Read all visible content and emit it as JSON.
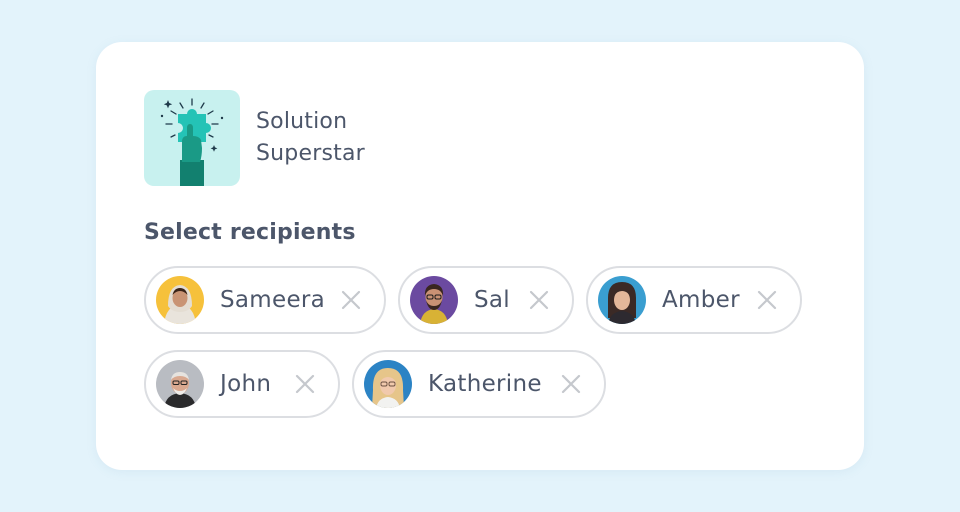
{
  "award": {
    "title_line1": "Solution",
    "title_line2": "Superstar",
    "icon": "puzzle-hand-icon",
    "icon_bg": "#c8f1ef",
    "accent": "#1fbfb0"
  },
  "recipients": {
    "heading": "Select recipients",
    "people": [
      {
        "name": "Sameera",
        "avatar_bg": "#f6c13b"
      },
      {
        "name": "Sal",
        "avatar_bg": "#6b4aa0"
      },
      {
        "name": "Amber",
        "avatar_bg": "#3a9ed0"
      },
      {
        "name": "John",
        "avatar_bg": "#b9bcc2"
      },
      {
        "name": "Katherine",
        "avatar_bg": "#2c83c4"
      }
    ],
    "remove_icon": "close-icon"
  },
  "colors": {
    "page_bg": "#e3f3fb",
    "card_bg": "#ffffff",
    "text": "#4c566a",
    "chip_border": "#dcdee2",
    "remove_icon": "#c5c8cd"
  }
}
